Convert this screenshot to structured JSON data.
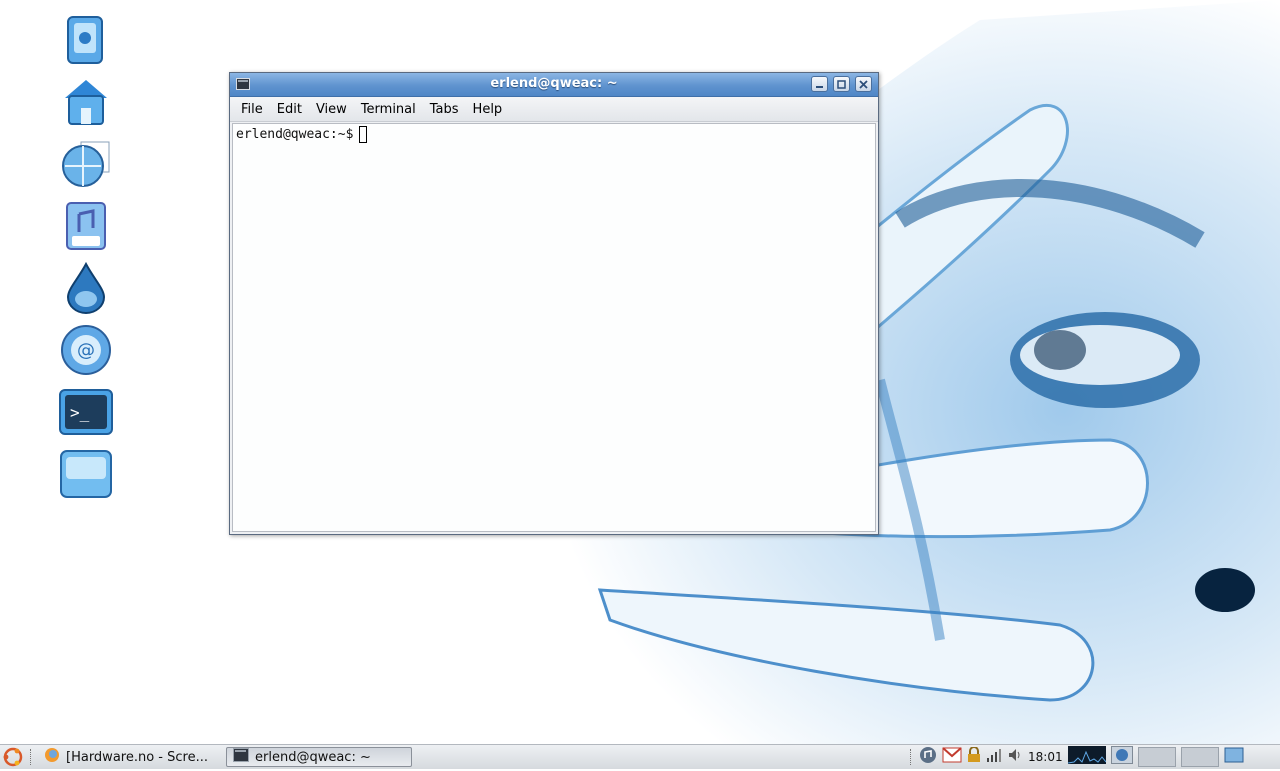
{
  "colors": {
    "accent": "#4f86c6",
    "wallpaper_blue": "#1f6fb8"
  },
  "desktop_icons": [
    {
      "name": "computer-icon"
    },
    {
      "name": "home-folder-icon"
    },
    {
      "name": "network-globe-icon"
    },
    {
      "name": "mp3-file-icon"
    },
    {
      "name": "water-drop-icon"
    },
    {
      "name": "email-icon"
    },
    {
      "name": "terminal-icon"
    },
    {
      "name": "trash-icon"
    }
  ],
  "window": {
    "title": "erlend@qweac: ~",
    "menu": [
      "File",
      "Edit",
      "View",
      "Terminal",
      "Tabs",
      "Help"
    ],
    "prompt": "erlend@qweac:~$"
  },
  "taskbar": {
    "tasks": [
      {
        "label": "[Hardware.no - Scre...",
        "icon": "firefox-icon",
        "active": false
      },
      {
        "label": "erlend@qweac: ~",
        "icon": "terminal-icon",
        "active": true
      }
    ],
    "clock": "18:01"
  }
}
